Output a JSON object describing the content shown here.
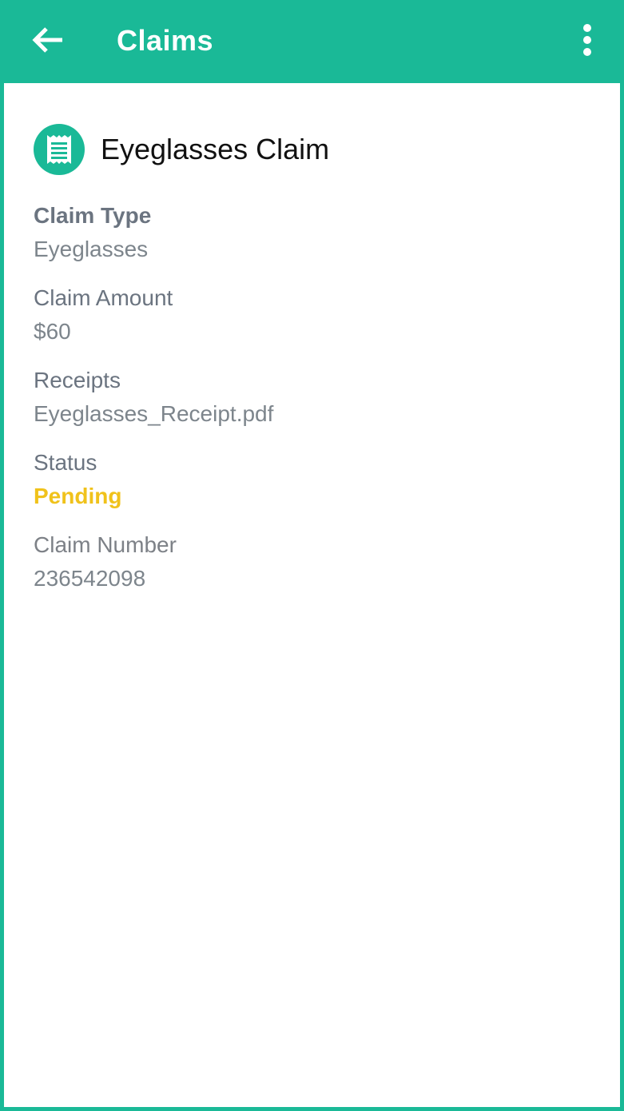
{
  "app_bar": {
    "title": "Claims",
    "back_icon": "arrow-back-icon",
    "menu_icon": "more-vert-icon",
    "color": "#1ab997"
  },
  "claim": {
    "title": "Eyeglasses Claim",
    "icon": "receipt-icon",
    "fields": [
      {
        "label": "Claim Type",
        "value": "Eyeglasses"
      },
      {
        "label": "Claim Amount",
        "value": "$60"
      },
      {
        "label": "Receipts",
        "value": "Eyeglasses_Receipt.pdf"
      },
      {
        "label": "Status",
        "value": "Pending"
      },
      {
        "label": "Claim Number",
        "value": "236542098"
      }
    ]
  },
  "colors": {
    "accent": "#1ab997",
    "status_pending": "#f0c21b",
    "label": "#6b7480",
    "value": "#7d858c"
  }
}
